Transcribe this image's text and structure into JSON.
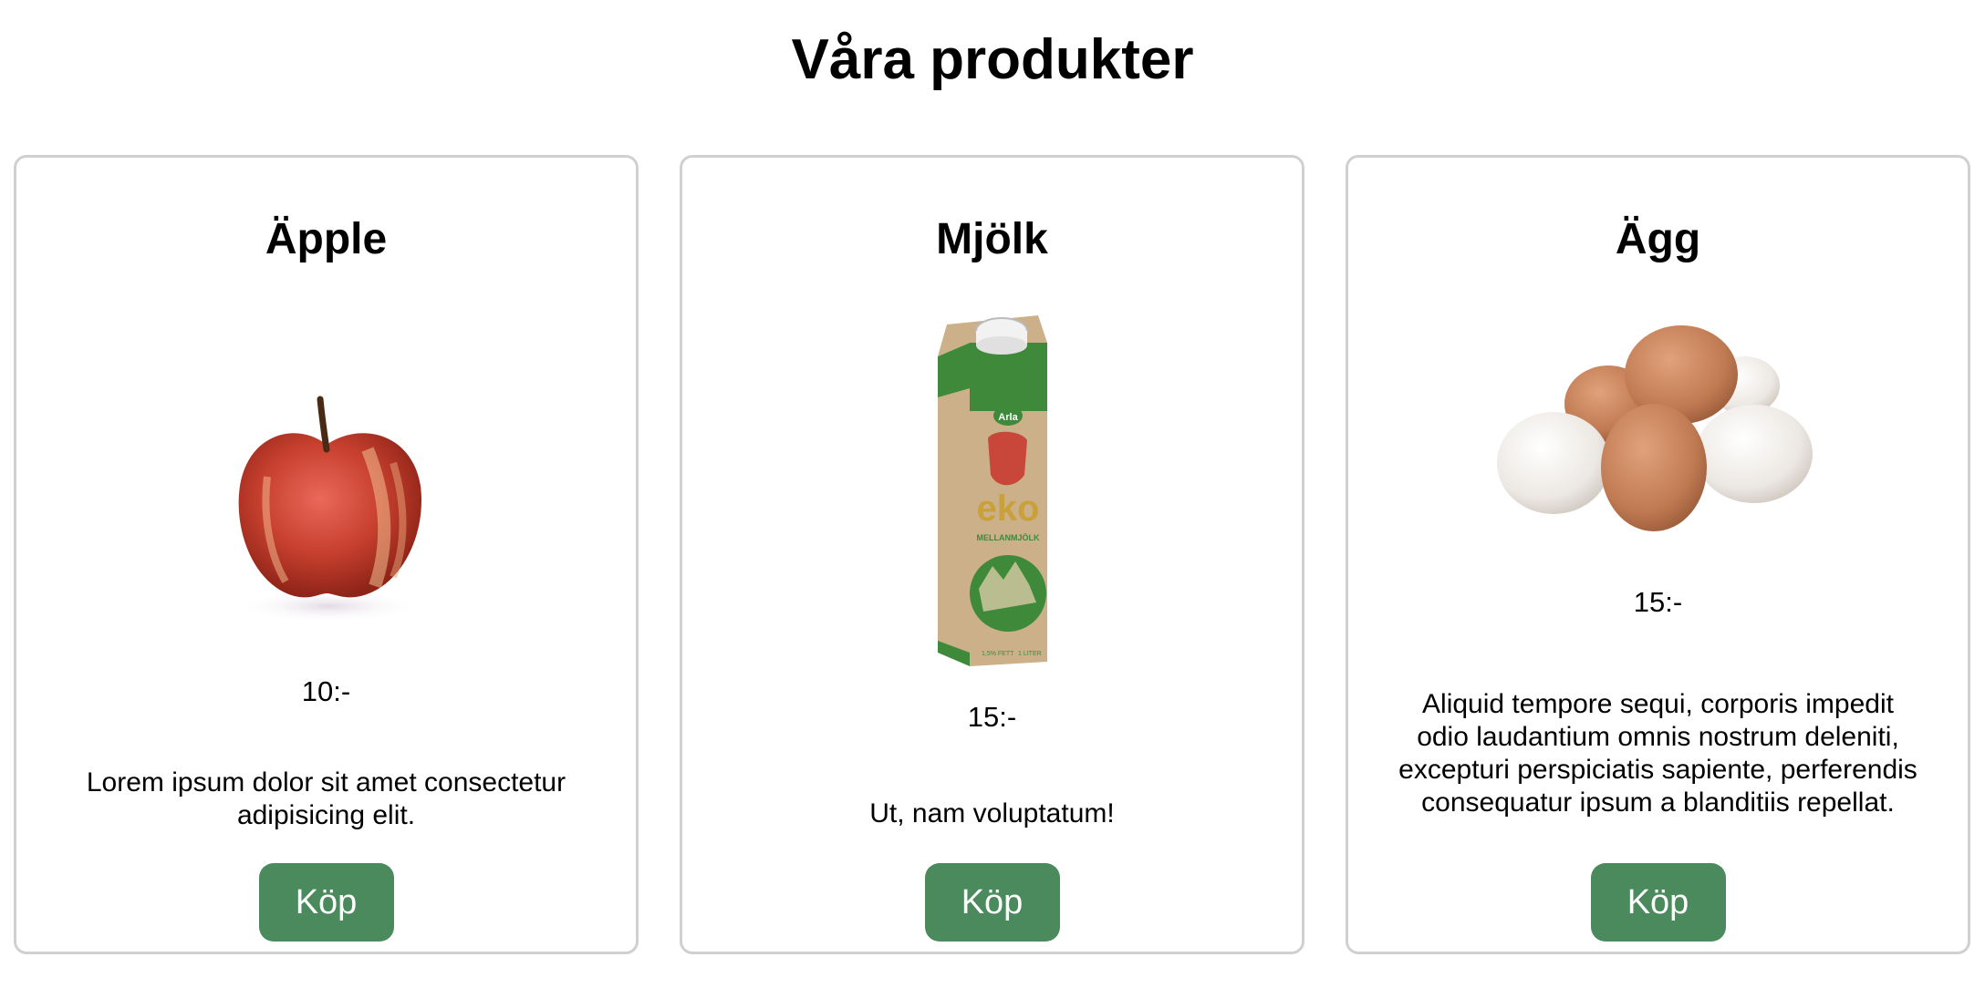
{
  "page": {
    "title": "Våra produkter"
  },
  "products": [
    {
      "name": "Äpple",
      "price": "10:-",
      "description": "Lorem ipsum dolor sit amet consectetur adipisicing elit.",
      "button_label": "Köp",
      "image_icon": "apple-image"
    },
    {
      "name": "Mjölk",
      "price": "15:-",
      "description": "Ut, nam voluptatum!",
      "button_label": "Köp",
      "image_icon": "milk-carton-image",
      "image_text": [
        "Arla",
        "eko",
        "MELLANMJÖLK",
        "1,5% FETT",
        "1 LITER"
      ]
    },
    {
      "name": "Ägg",
      "price": "15:-",
      "description": "Aliquid tempore sequi, corporis impedit odio laudantium omnis nostrum deleniti, excepturi perspiciatis sapiente, perferendis consequatur ipsum a blanditiis repellat.",
      "button_label": "Köp",
      "image_icon": "eggs-image"
    }
  ],
  "colors": {
    "button_bg": "#4a8a5c",
    "card_border": "#d0d0d0",
    "milk_green": "#3f8a3a",
    "carton_kraft": "#cbb08a"
  }
}
